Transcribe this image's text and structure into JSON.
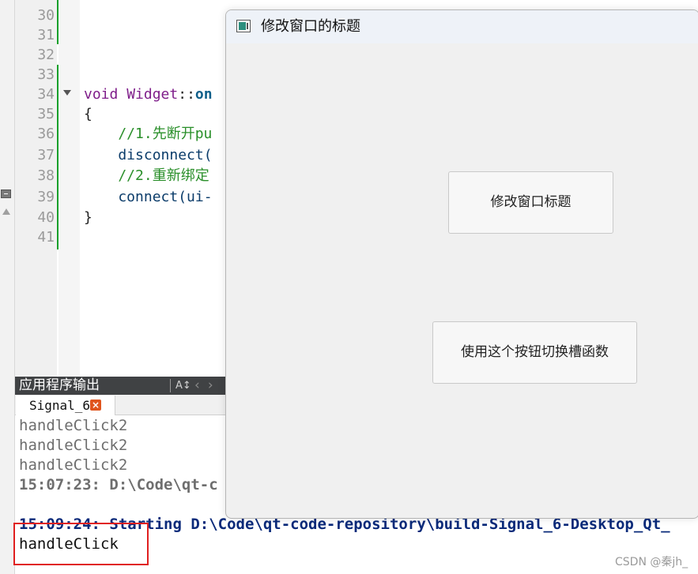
{
  "editor": {
    "line_numbers": [
      "30",
      "31",
      "32",
      "33",
      "34",
      "35",
      "36",
      "37",
      "38",
      "39",
      "40",
      "41"
    ],
    "code": {
      "line34_kw": "void",
      "line34_class": "Widget",
      "line34_sep": "::",
      "line34_fn": "on",
      "line35": "{",
      "line36": "    //1.先断开pu",
      "line37": "    disconnect(",
      "line38": "    //2.重新绑定",
      "line39": "    connect(ui-",
      "line40": "}"
    }
  },
  "output_panel": {
    "title": "应用程序输出",
    "tab_label": "Signal_6",
    "tab_close": "×",
    "lines": {
      "l1": "handleClick2",
      "l2": "handleClick2",
      "l3": "handleClick2",
      "l4": "15:07:23: D:\\Code\\qt-c",
      "l5": "15:09:24: Starting D:\\Code\\qt-code-repository\\build-Signal_6-Desktop_Qt_",
      "l6": "handleClick"
    }
  },
  "dialog": {
    "title": "修改窗口的标题",
    "button_change_title": "修改窗口标题",
    "button_switch_slot": "使用这个按钮切换槽函数"
  },
  "watermark": "CSDN @秦jh_"
}
